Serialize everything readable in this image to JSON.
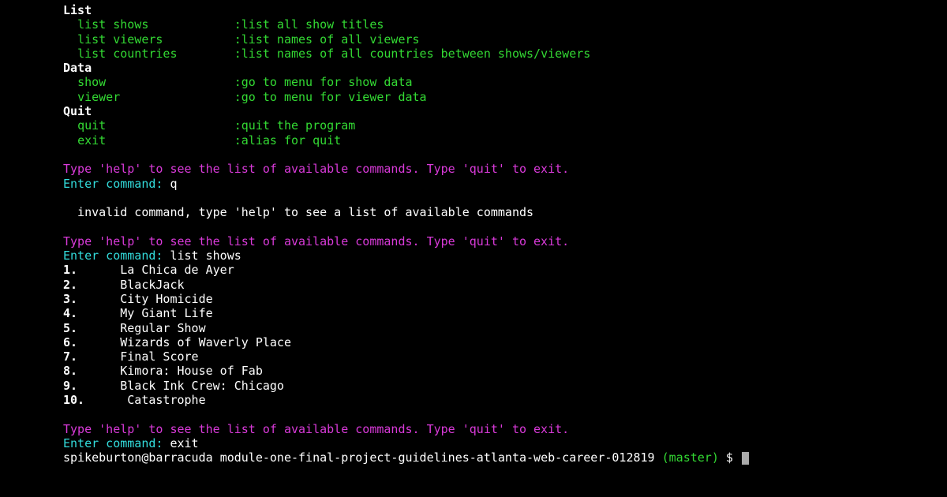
{
  "menu": {
    "sections": [
      {
        "title": "List",
        "items": [
          {
            "cmd": "list shows",
            "desc": ":list all show titles"
          },
          {
            "cmd": "list viewers",
            "desc": ":list names of all viewers"
          },
          {
            "cmd": "list countries",
            "desc": ":list names of all countries between shows/viewers"
          }
        ]
      },
      {
        "title": "Data",
        "items": [
          {
            "cmd": "show",
            "desc": ":go to menu for show data"
          },
          {
            "cmd": "viewer",
            "desc": ":go to menu for viewer data"
          }
        ]
      },
      {
        "title": "Quit",
        "items": [
          {
            "cmd": "quit",
            "desc": ":quit the program"
          },
          {
            "cmd": "exit",
            "desc": ":alias for quit"
          }
        ]
      }
    ]
  },
  "hint": "Type 'help' to see the list of available commands. Type 'quit' to exit.",
  "enter_prompt": "Enter command: ",
  "inputs": {
    "first": "q",
    "second": "list shows",
    "third": "exit"
  },
  "invalid_msg": "  invalid command, type 'help' to see a list of available commands",
  "shows": [
    "La Chica de Ayer",
    "BlackJack",
    "City Homicide",
    "My Giant Life",
    "Regular Show",
    "Wizards of Waverly Place",
    "Final Score",
    "Kimora: House of Fab",
    "Black Ink Crew: Chicago",
    "Catastrophe"
  ],
  "shell_prompt": {
    "user_host": "spikeburton@barracuda",
    "path": "module-one-final-project-guidelines-atlanta-web-career-012819",
    "branch": "(master)",
    "symbol": "$"
  }
}
